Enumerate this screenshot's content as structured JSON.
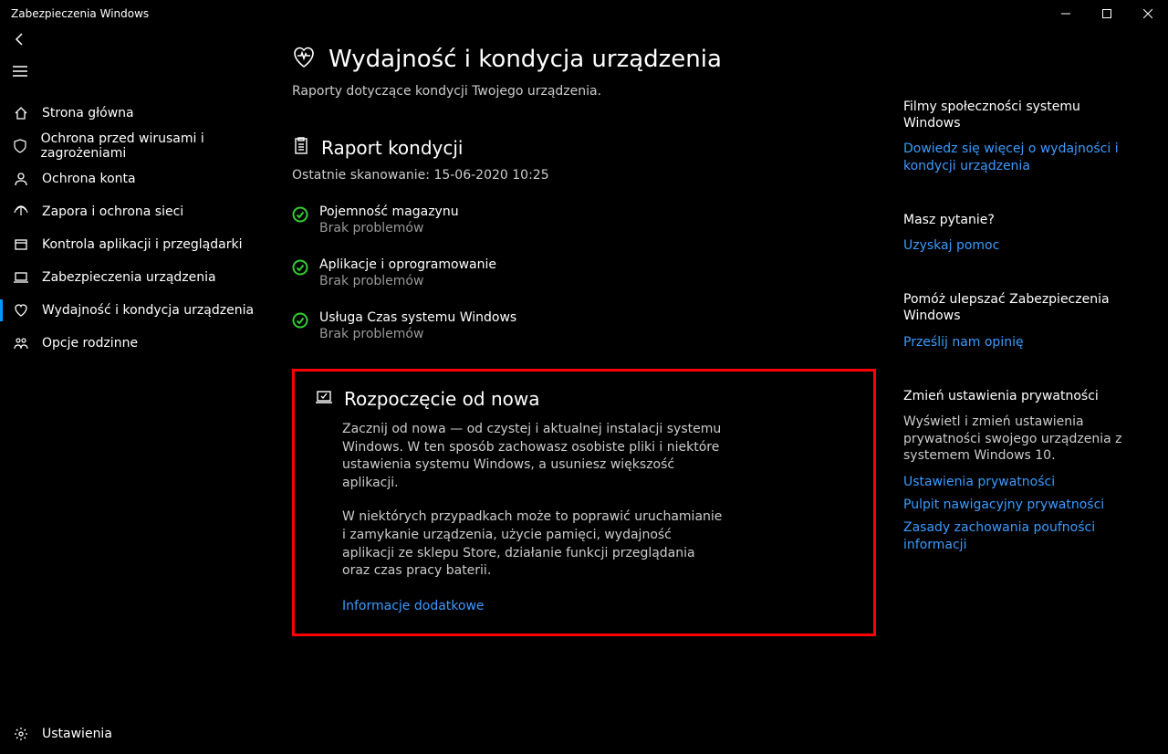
{
  "titlebar": {
    "app_title": "Zabezpieczenia Windows"
  },
  "sidebar": {
    "items": [
      {
        "label": "Strona główna"
      },
      {
        "label": "Ochrona przed wirusami i zagrożeniami"
      },
      {
        "label": "Ochrona konta"
      },
      {
        "label": "Zapora i ochrona sieci"
      },
      {
        "label": "Kontrola aplikacji i przeglądarki"
      },
      {
        "label": "Zabezpieczenia urządzenia"
      },
      {
        "label": "Wydajność i kondycja urządzenia"
      },
      {
        "label": "Opcje rodzinne"
      }
    ],
    "settings_label": "Ustawienia"
  },
  "page": {
    "title": "Wydajność i kondycja urządzenia",
    "subtitle": "Raporty dotyczące kondycji Twojego urządzenia."
  },
  "report": {
    "title": "Raport kondycji",
    "last_scan": "Ostatnie skanowanie: 15-06-2020 10:25",
    "items": [
      {
        "title": "Pojemność magazynu",
        "status": "Brak problemów"
      },
      {
        "title": "Aplikacje i oprogramowanie",
        "status": "Brak problemów"
      },
      {
        "title": "Usługa Czas systemu Windows",
        "status": "Brak problemów"
      }
    ]
  },
  "fresh": {
    "title": "Rozpoczęcie od nowa",
    "p1": "Zacznij od nowa — od czystej i aktualnej instalacji systemu Windows. W ten sposób zachowasz osobiste pliki i niektóre ustawienia systemu Windows, a usuniesz większość aplikacji.",
    "p2": "W niektórych przypadkach może to poprawić uruchamianie i zamykanie urządzenia, użycie pamięci, wydajność aplikacji ze sklepu Store, działanie funkcji przeglądania oraz czas pracy baterii.",
    "link": "Informacje dodatkowe"
  },
  "right": {
    "community": {
      "title": "Filmy społeczności systemu Windows",
      "link": "Dowiedz się więcej o wydajności i kondycji urządzenia"
    },
    "question": {
      "title": "Masz pytanie?",
      "link": "Uzyskaj pomoc"
    },
    "improve": {
      "title": "Pomóż ulepszać Zabezpieczenia Windows",
      "link": "Prześlij nam opinię"
    },
    "privacy": {
      "title": "Zmień ustawienia prywatności",
      "text": "Wyświetl i zmień ustawienia prywatności swojego urządzenia z systemem Windows 10.",
      "link1": "Ustawienia prywatności",
      "link2": "Pulpit nawigacyjny prywatności",
      "link3": "Zasady zachowania poufności informacji"
    }
  }
}
